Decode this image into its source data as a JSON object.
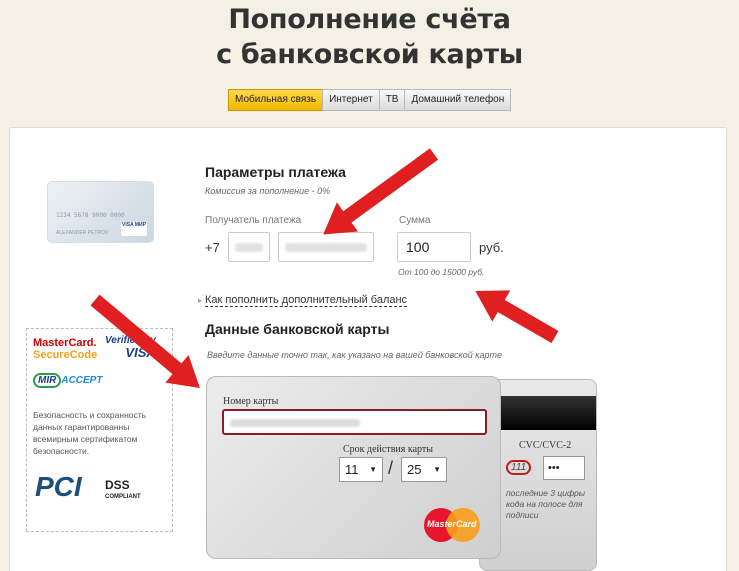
{
  "page": {
    "title_line1": "Пополнение счёта",
    "title_line2": "с банковской карты"
  },
  "tabs": [
    {
      "label": "Мобильная связь",
      "active": true
    },
    {
      "label": "Интернет",
      "active": false
    },
    {
      "label": "ТВ",
      "active": false
    },
    {
      "label": "Домашний телефон",
      "active": false
    }
  ],
  "sample_card": {
    "number": "1234 5678 9000 0000",
    "name": "ALEXANDER PETROV",
    "logo": "VISA МИР"
  },
  "payment": {
    "title": "Параметры платежа",
    "commission": "Комиссия за пополнение - 0%",
    "recipient_label": "Получатель платежа",
    "prefix": "+7",
    "amount_label": "Сумма",
    "amount_value": "100",
    "currency": "руб.",
    "amount_hint": "От 100 до 15000 руб.",
    "extra_link": "Как пополнить дополнительный баланс"
  },
  "card_data": {
    "title": "Данные банковской карты",
    "hint": "Введите данные точно так, как указано на вашей банковской карте",
    "number_label": "Номер карты",
    "expiry_label": "Срок действия карты",
    "month": "11",
    "year": "25",
    "separator": "/",
    "cvc_label": "CVC/CVC-2",
    "cvc_sample": "111",
    "cvc_value": "•••",
    "cvc_hint": "последние 3 цифры кода на полосе для подписи",
    "brand": "MasterCard"
  },
  "security": {
    "mc_line1": "MasterCard.",
    "mc_line2": "SecureCode",
    "vbv_line1": "Verified by",
    "vbv_line2": "VISA",
    "mir_m": "MIR",
    "mir_text": "ACCEPT",
    "text": "Безопасность и сохранность данных гарантированны всемирным сертификатом безопасности.",
    "pci": "PCI",
    "dss": "DSS",
    "dss_sub": "COMPLIANT"
  },
  "colors": {
    "annotation_arrow": "#e02020",
    "active_tab": "#f2b800",
    "card_input_border": "#8a1c2a"
  }
}
